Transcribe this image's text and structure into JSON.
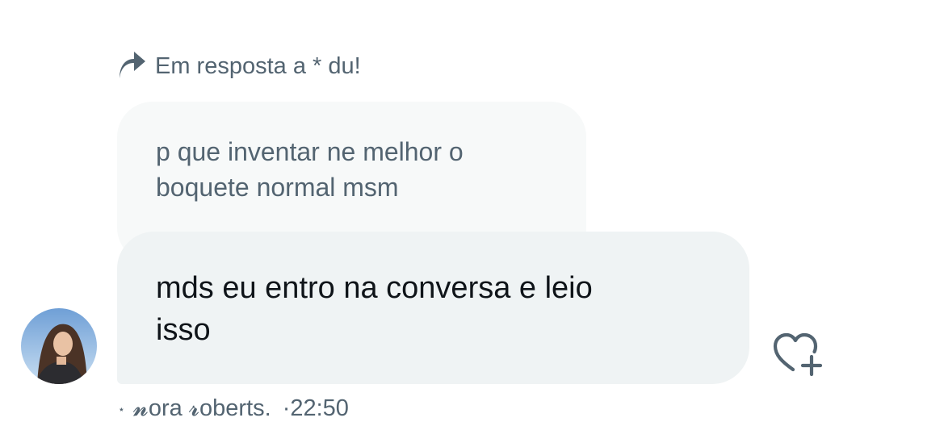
{
  "reply": {
    "label": "Em resposta a * du!",
    "icon": "reply-arrow-icon"
  },
  "quoted_message": {
    "line1": "p que inventar ne melhor o",
    "line2": "boquete normal msm"
  },
  "message": {
    "line1": "mds eu entro na conversa e leio",
    "line2": "isso"
  },
  "sender": {
    "prefix": "⋆",
    "name": "𝓷ora 𝓻oberts.",
    "time": "·22:50"
  },
  "actions": {
    "react_icon": "heart-add-icon"
  },
  "colors": {
    "secondary_text": "#536471",
    "primary_text": "#0f1419",
    "quoted_bubble": "#f7f9f9",
    "message_bubble": "#eff3f4"
  }
}
